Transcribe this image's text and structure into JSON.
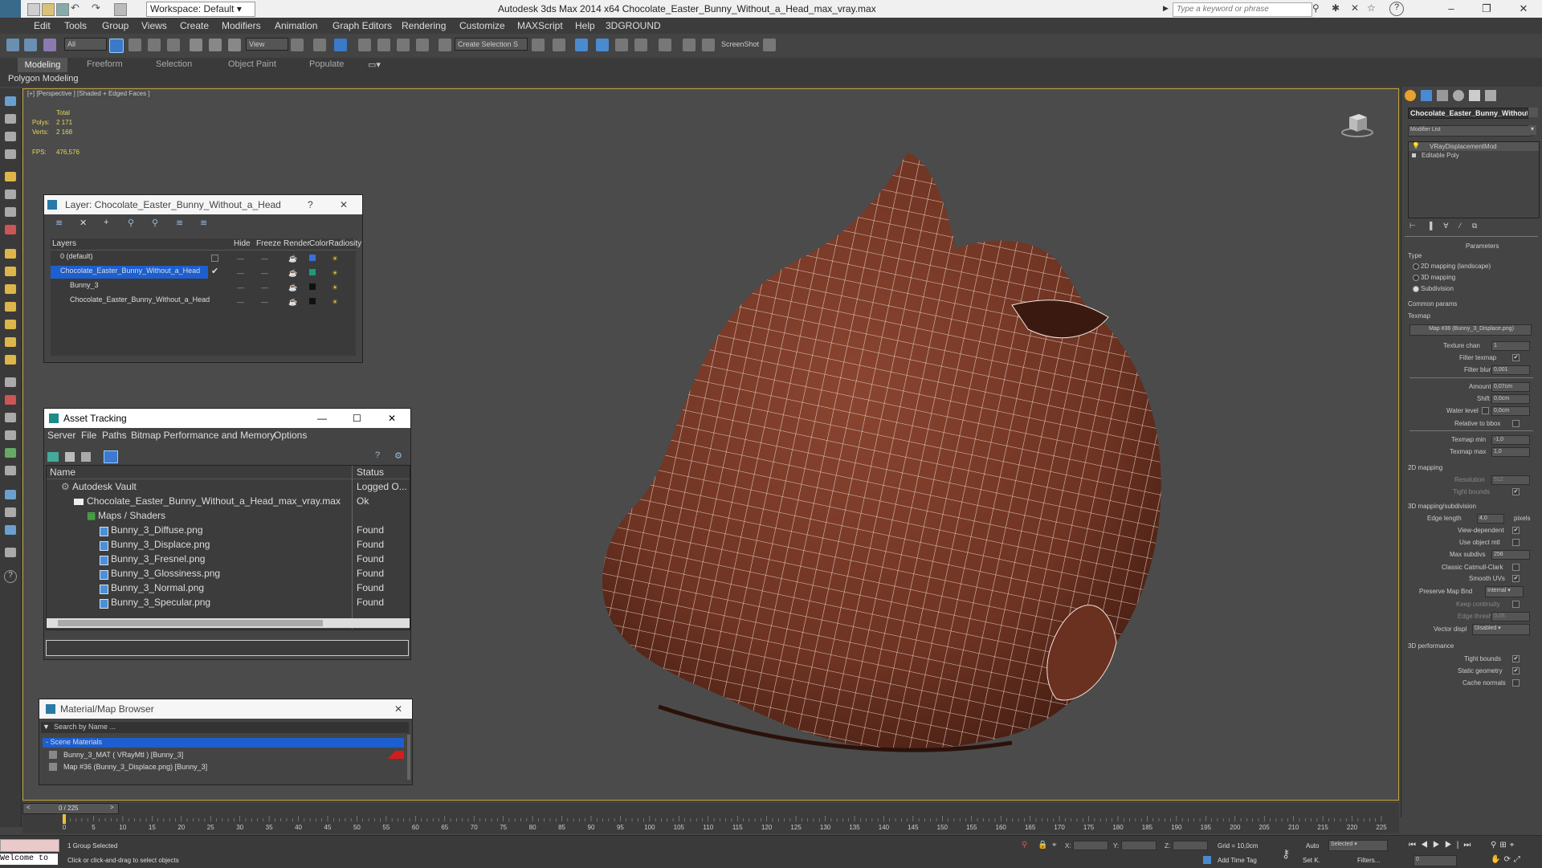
{
  "window": {
    "title": "Autodesk 3ds Max  2014 x64     Chocolate_Easter_Bunny_Without_a_Head_max_vray.max",
    "workspace": "Workspace: Default",
    "search_placeholder": "Type a keyword or phrase"
  },
  "menubar": {
    "items": [
      "Edit",
      "Tools",
      "Group",
      "Views",
      "Create",
      "Modifiers",
      "Animation",
      "Graph Editors",
      "Rendering",
      "Customize",
      "MAXScript",
      "Help",
      "3DGROUND"
    ]
  },
  "toolbar": {
    "selection_filter": "All",
    "ref_coord": "View",
    "named_selection": "Create Selection S",
    "screenshot_label": "ScreenShot"
  },
  "ribbon": {
    "tabs": [
      "Modeling",
      "Freeform",
      "Selection",
      "Object Paint",
      "Populate"
    ],
    "active_tab": "Modeling",
    "panel_label": "Polygon Modeling"
  },
  "viewport": {
    "label": "[+] [Perspective ] [Shaded + Edged Faces ]",
    "stats": {
      "total_label": "Total",
      "polys_label": "Polys:",
      "polys": "2 171",
      "verts_label": "Verts:",
      "verts": "2 168",
      "fps_label": "FPS:",
      "fps": "476,576"
    },
    "model_color": "#7a3a28",
    "wire_color": "#ffffff"
  },
  "layer_dialog": {
    "title": "Layer: Chocolate_Easter_Bunny_Without_a_Head",
    "help": "?",
    "columns": [
      "Layers",
      "Hide",
      "Freeze",
      "Render",
      "Color",
      "Radiosity"
    ],
    "rows": [
      {
        "name": "0 (default)",
        "color": "#3a6fd8"
      },
      {
        "name": "Chocolate_Easter_Bunny_Without_a_Head",
        "color": "#1c9a7a"
      },
      {
        "name": "Bunny_3",
        "color": "#111111"
      },
      {
        "name": "Chocolate_Easter_Bunny_Without_a_Head",
        "color": "#111111"
      }
    ]
  },
  "asset_tracking": {
    "title": "Asset Tracking",
    "menus": [
      "Server",
      "File",
      "Paths",
      "Bitmap Performance and Memory",
      "Options"
    ],
    "columns": [
      "Name",
      "Status"
    ],
    "rows": [
      {
        "name": "Autodesk Vault",
        "status": "Logged O..."
      },
      {
        "name": "Chocolate_Easter_Bunny_Without_a_Head_max_vray.max",
        "status": "Ok"
      },
      {
        "name": "Maps / Shaders",
        "status": ""
      },
      {
        "name": "Bunny_3_Diffuse.png",
        "status": "Found"
      },
      {
        "name": "Bunny_3_Displace.png",
        "status": "Found"
      },
      {
        "name": "Bunny_3_Fresnel.png",
        "status": "Found"
      },
      {
        "name": "Bunny_3_Glossiness.png",
        "status": "Found"
      },
      {
        "name": "Bunny_3_Normal.png",
        "status": "Found"
      },
      {
        "name": "Bunny_3_Specular.png",
        "status": "Found"
      }
    ]
  },
  "material_browser": {
    "title": "Material/Map Browser",
    "search_placeholder": "Search by Name ...",
    "group": "- Scene Materials",
    "items": [
      "Bunny_3_MAT ( VRayMtl ) [Bunny_3]",
      "Map #36 (Bunny_3_Displace.png) [Bunny_3]"
    ]
  },
  "command_panel": {
    "object_name": "Chocolate_Easter_Bunny_Without",
    "modifier_list": "Modifier List",
    "stack": [
      "VRayDisplacementMod",
      "Editable Poly"
    ],
    "parameters_header": "Parameters",
    "type_label": "Type",
    "type_options": [
      "2D mapping (landscape)",
      "3D mapping",
      "Subdivision"
    ],
    "type_selected": "Subdivision",
    "common_params": "Common params",
    "texmap_label": "Texmap",
    "texmap_value": "Map #36 (Bunny_3_Displace.png)",
    "texture_chan_label": "Texture chan",
    "texture_chan": "1",
    "filter_texmap_label": "Filter texmap",
    "filter_blur_label": "Filter blur",
    "filter_blur": "0,001",
    "amount_label": "Amount",
    "amount": "0,07cm",
    "shift_label": "Shift",
    "shift": "0,0cm",
    "water_level_label": "Water level",
    "water_level": "0,0cm",
    "relative_bbox": "Relative to bbox",
    "texmap_min_label": "Texmap min",
    "texmap_min": "-1,0",
    "texmap_max_label": "Texmap max",
    "texmap_max": "1,0",
    "mapping2d_header": "2D mapping",
    "resolution_label": "Resolution",
    "resolution": "512",
    "tight_bounds_label": "Tight bounds",
    "mapping3d_header": "3D mapping/subdivision",
    "edge_length_label": "Edge length",
    "edge_length": "4,0",
    "pixels_label": "pixels",
    "view_dependent": "View-dependent",
    "use_object_mtl": "Use object mtl",
    "max_subdivs_label": "Max subdivs",
    "max_subdivs": "256",
    "classic_catmull": "Classic Catmull-Clark",
    "smooth_uvs": "Smooth UVs",
    "preserve_map_bnd_label": "Preserve Map Bnd",
    "preserve_map_bnd": "Internal",
    "keep_continuity": "Keep continuity",
    "edge_thresh_label": "Edge thresh",
    "edge_thresh": "0,05",
    "vector_displ_label": "Vector displ",
    "vector_displ": "Disabled",
    "perf_header": "3D performance",
    "perf_tight_bounds": "Tight bounds",
    "static_geometry": "Static geometry",
    "cache_normals": "Cache normals"
  },
  "timeline": {
    "frame_display": "0 / 225",
    "ticks": [
      "0",
      "5",
      "10",
      "15",
      "20",
      "25",
      "30",
      "35",
      "40",
      "45",
      "50",
      "55",
      "60",
      "65",
      "70",
      "75",
      "80",
      "85",
      "90",
      "95",
      "100",
      "105",
      "110",
      "115",
      "120",
      "125",
      "130",
      "135",
      "140",
      "145",
      "150",
      "155",
      "160",
      "165",
      "170",
      "175",
      "180",
      "185",
      "190",
      "195",
      "200",
      "205",
      "210",
      "215",
      "220",
      "225"
    ]
  },
  "status": {
    "listener": "Welcome to",
    "selection": "1 Group Selected",
    "prompt": "Click or click-and-drag to select objects",
    "x_label": "X:",
    "y_label": "Y:",
    "z_label": "Z:",
    "grid": "Grid = 10,0cm",
    "add_time_tag": "Add Time Tag",
    "auto": "Auto",
    "set_k": "Set K.",
    "selected": "Selected",
    "filters": "Filters...",
    "frame": "0"
  }
}
